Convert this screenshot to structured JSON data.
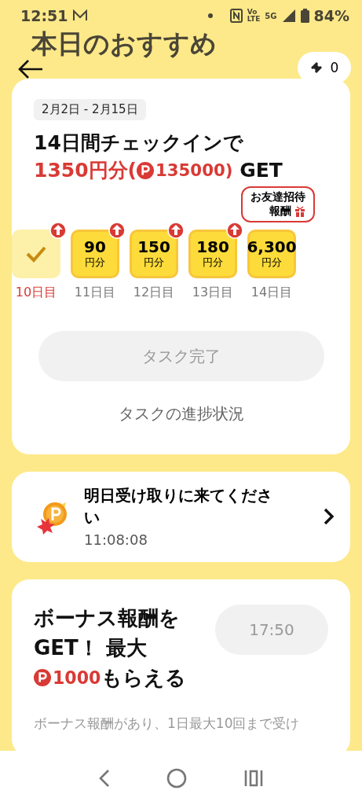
{
  "status_bar": {
    "time": "12:51",
    "volte_top": "Vo",
    "volte_bottom": "LTE",
    "network": "5G",
    "battery": "84%"
  },
  "header": {
    "title": "本日のおすすめ",
    "ticket_count": "0"
  },
  "checkin_card": {
    "date_range": "2月2日 - 2月15日",
    "headline": "14日間チェックインで",
    "reward_line": [
      {
        "kind": "red",
        "text": "1350円分("
      },
      {
        "kind": "point",
        "text": "135000)"
      },
      {
        "kind": "plain",
        "text": " GET"
      }
    ],
    "tooltip": {
      "line1": "お友達招待",
      "line2": "報酬"
    },
    "days": [
      {
        "label": "10日目",
        "checked": true,
        "boost": true,
        "selected": true
      },
      {
        "amount": "90",
        "unit": "円分",
        "label": "11日目",
        "checked": false,
        "boost": true,
        "selected": false
      },
      {
        "amount": "150",
        "unit": "円分",
        "label": "12日目",
        "checked": false,
        "boost": true,
        "selected": false
      },
      {
        "amount": "180",
        "unit": "円分",
        "label": "13日目",
        "checked": false,
        "boost": true,
        "selected": false
      },
      {
        "amount": "6,300",
        "unit": "円分",
        "label": "14日目",
        "checked": false,
        "boost": false,
        "selected": false
      }
    ],
    "complete_button": {
      "label": "タスク完了",
      "disabled": true
    },
    "progress_link": "タスクの進捗状況"
  },
  "claim_card": {
    "title": "明日受け取りに来てください",
    "timer": "11:08:08"
  },
  "bonus_card": {
    "title": [
      {
        "kind": "plain",
        "text": "ボーナス報酬をGET！ 最大"
      },
      {
        "kind": "point",
        "text": "1000"
      },
      {
        "kind": "plain",
        "text": "もらえる"
      }
    ],
    "timer_button": {
      "label": "17:50",
      "disabled": true
    },
    "description": "ボーナス報酬があり、1日最大10回まで受け"
  }
}
